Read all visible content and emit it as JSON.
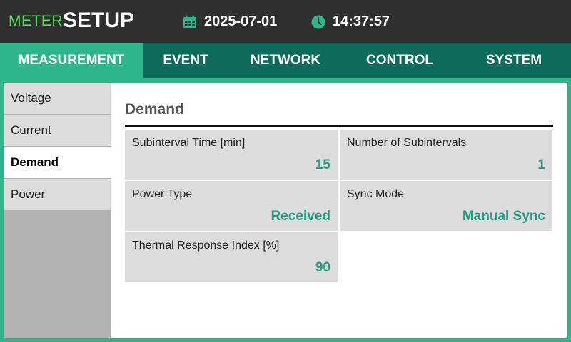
{
  "header": {
    "brand_prefix": "METER",
    "title": "SETUP",
    "date": "2025-07-01",
    "time": "14:37:57",
    "icons": {
      "date": "calendar-icon",
      "time": "clock-icon"
    }
  },
  "tabs": [
    {
      "label": "MEASUREMENT",
      "active": true
    },
    {
      "label": "EVENT",
      "active": false
    },
    {
      "label": "NETWORK",
      "active": false
    },
    {
      "label": "CONTROL",
      "active": false
    },
    {
      "label": "SYSTEM",
      "active": false
    }
  ],
  "sidebar": {
    "items": [
      {
        "label": "Voltage",
        "active": false
      },
      {
        "label": "Current",
        "active": false
      },
      {
        "label": "Demand",
        "active": true
      },
      {
        "label": "Power",
        "active": false
      }
    ]
  },
  "main": {
    "section_title": "Demand",
    "fields": [
      {
        "label": "Subinterval Time [min]",
        "value": "15"
      },
      {
        "label": "Number of Subintervals",
        "value": "1"
      },
      {
        "label": "Power Type",
        "value": "Received"
      },
      {
        "label": "Sync Mode",
        "value": "Manual Sync"
      },
      {
        "label": "Thermal Response Index [%]",
        "value": "90"
      }
    ]
  },
  "colors": {
    "accent": "#2fb58c",
    "tab_bar": "#0d6b5c",
    "brand_green": "#5ae05a",
    "value_text": "#249a82"
  }
}
